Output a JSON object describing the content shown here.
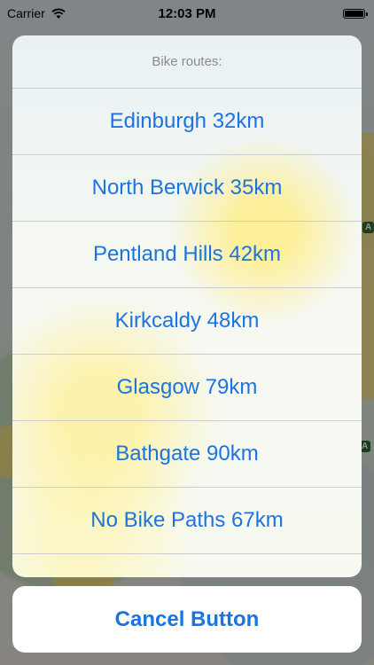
{
  "status_bar": {
    "carrier": "Carrier",
    "time": "12:03 PM"
  },
  "action_sheet": {
    "title": "Bike routes:",
    "options": [
      "Edinburgh 32km",
      "North Berwick 35km",
      "Pentland Hills 42km",
      "Kirkcaldy 48km",
      "Glasgow 79km",
      "Bathgate 90km",
      "No Bike Paths 67km"
    ],
    "cancel_label": "Cancel Button"
  },
  "colors": {
    "accent": "#1b74e0",
    "title_gray": "#8a8a8f"
  },
  "icons": [
    "wifi-icon",
    "battery-icon"
  ]
}
